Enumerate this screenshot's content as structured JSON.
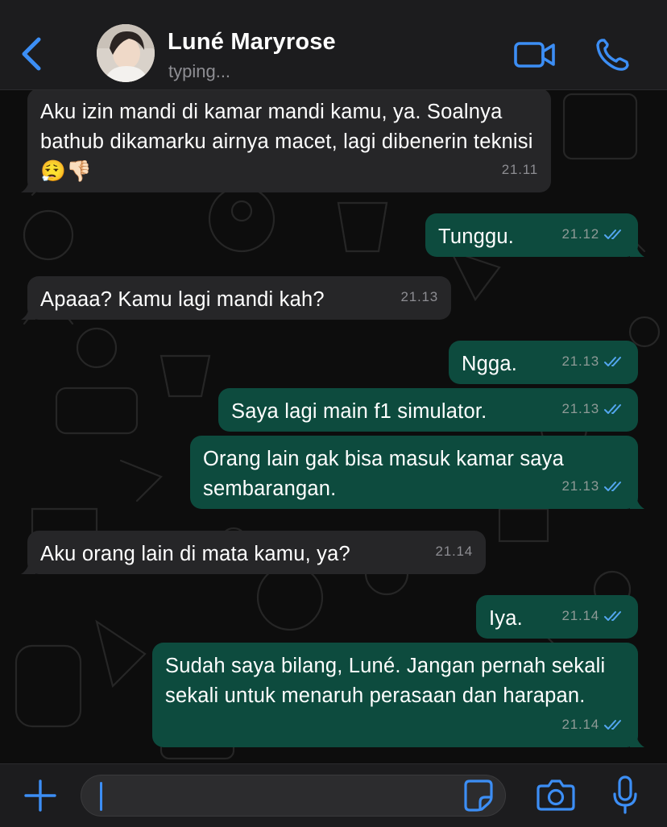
{
  "header": {
    "contact_name": "Luné Maryrose",
    "status": "typing..."
  },
  "colors": {
    "accent": "#3c8ef5",
    "incoming_bubble": "#262628",
    "outgoing_bubble": "#0d4b3e",
    "read_ticks": "#53a6ef"
  },
  "icons": {
    "back": "chevron-left-icon",
    "video": "video-camera-icon",
    "call": "phone-icon",
    "plus": "plus-icon",
    "sticker": "sticker-icon",
    "camera": "camera-icon",
    "mic": "microphone-icon"
  },
  "messages": [
    {
      "direction": "in",
      "text": "Aku izin mandi di kamar mandi kamu, ya. Soalnya bathub dikamarku airnya macet, lagi dibenerin teknisi 😮‍💨👎🏻",
      "time": "21.11"
    },
    {
      "direction": "out",
      "text": "Tunggu.",
      "time": "21.12",
      "status": "read"
    },
    {
      "direction": "in",
      "text": "Apaaa? Kamu lagi mandi kah?",
      "time": "21.13"
    },
    {
      "direction": "out",
      "text": "Ngga.",
      "time": "21.13",
      "status": "read"
    },
    {
      "direction": "out",
      "text": "Saya lagi main f1 simulator.",
      "time": "21.13",
      "status": "read"
    },
    {
      "direction": "out",
      "text": "Orang lain gak bisa masuk kamar saya sembarangan.",
      "time": "21.13",
      "status": "read"
    },
    {
      "direction": "in",
      "text": "Aku orang lain di mata kamu, ya?",
      "time": "21.14"
    },
    {
      "direction": "out",
      "text": "Iya.",
      "time": "21.14",
      "status": "read"
    },
    {
      "direction": "out",
      "text": "Sudah saya bilang, Luné. Jangan pernah sekali sekali untuk menaruh perasaan dan harapan.",
      "time": "21.14",
      "status": "read"
    }
  ],
  "composer": {
    "value": ""
  }
}
